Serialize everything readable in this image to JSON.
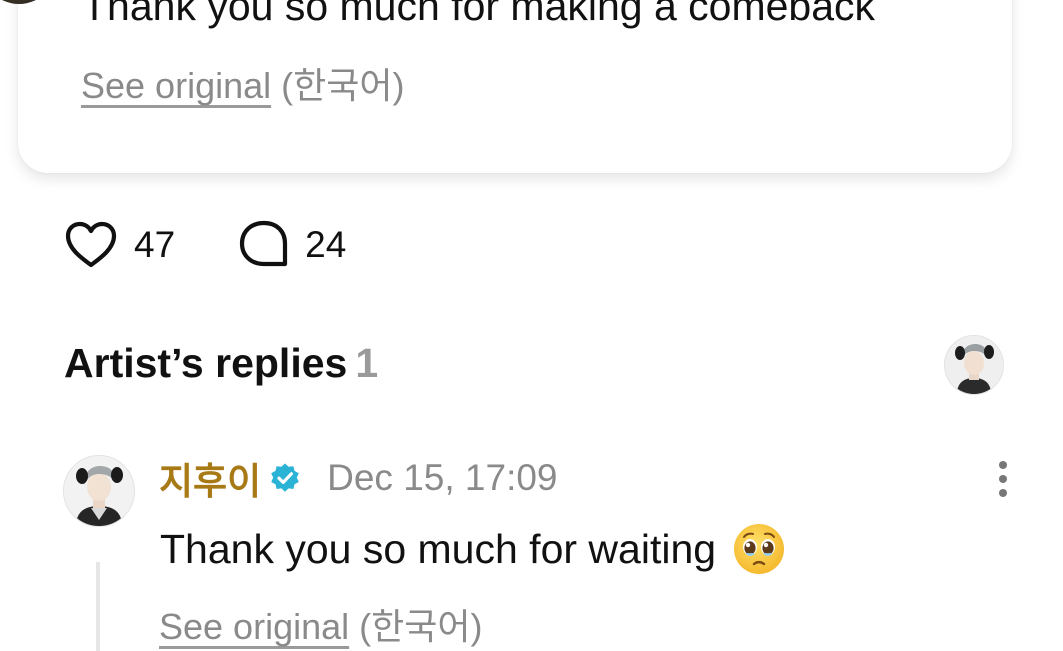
{
  "post": {
    "text": "Thank you so much for making a comeback",
    "see_original_label": "See original",
    "language_label": "(한국어)"
  },
  "actions": {
    "like_count": "47",
    "comment_count": "24"
  },
  "replies": {
    "title": "Artist’s replies",
    "count": "1"
  },
  "reply": {
    "author": "지후이",
    "timestamp": "Dec 15, 17:09",
    "text": "Thank you so much for waiting",
    "emoji_icon": "pleading-face-emoji",
    "see_original_label": "See original",
    "language_label": "(한국어)"
  },
  "icons": {
    "like": "heart-outline-icon",
    "comment": "speech-bubble-icon",
    "verified": "verified-badge-icon",
    "more": "vertical-ellipsis-icon"
  },
  "colors": {
    "author_name": "#a87a16",
    "verified_badge": "#2bb3d6",
    "muted_text": "#8a8a8a"
  }
}
